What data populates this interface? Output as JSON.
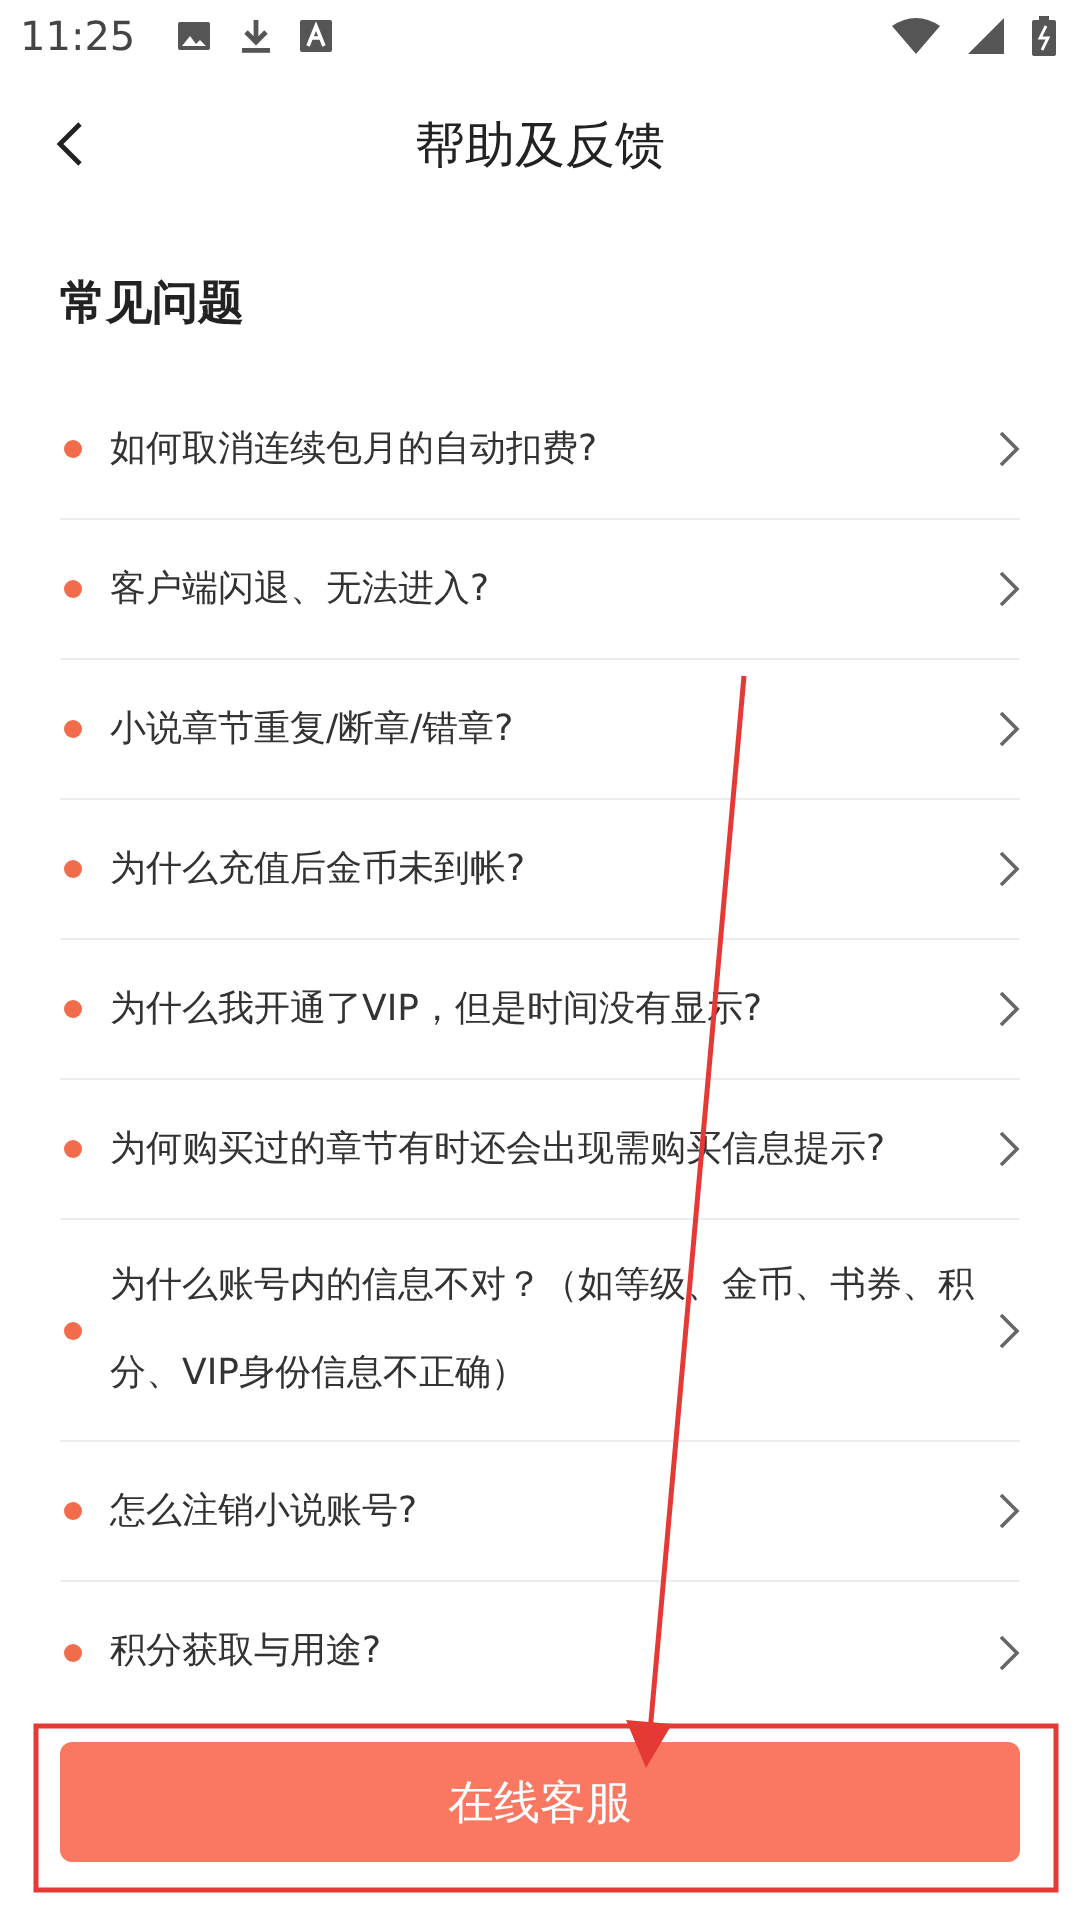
{
  "status_bar": {
    "time": "11:25"
  },
  "header": {
    "title": "帮助及反馈"
  },
  "section": {
    "title": "常见问题"
  },
  "faq": [
    {
      "text": "如何取消连续包月的自动扣费?"
    },
    {
      "text": "客户端闪退、无法进入?"
    },
    {
      "text": "小说章节重复/断章/错章?"
    },
    {
      "text": "为什么充值后金币未到帐?"
    },
    {
      "text": "为什么我开通了VIP，但是时间没有显示?"
    },
    {
      "text": "为何购买过的章节有时还会出现需购买信息提示?"
    },
    {
      "text": "为什么账号内的信息不对？（如等级、金币、书券、积分、VIP身份信息不正确）"
    },
    {
      "text": "怎么注销小说账号?"
    },
    {
      "text": "积分获取与用途?"
    }
  ],
  "button": {
    "label": "在线客服"
  },
  "annotations": {
    "arrow": true,
    "frame": true
  }
}
